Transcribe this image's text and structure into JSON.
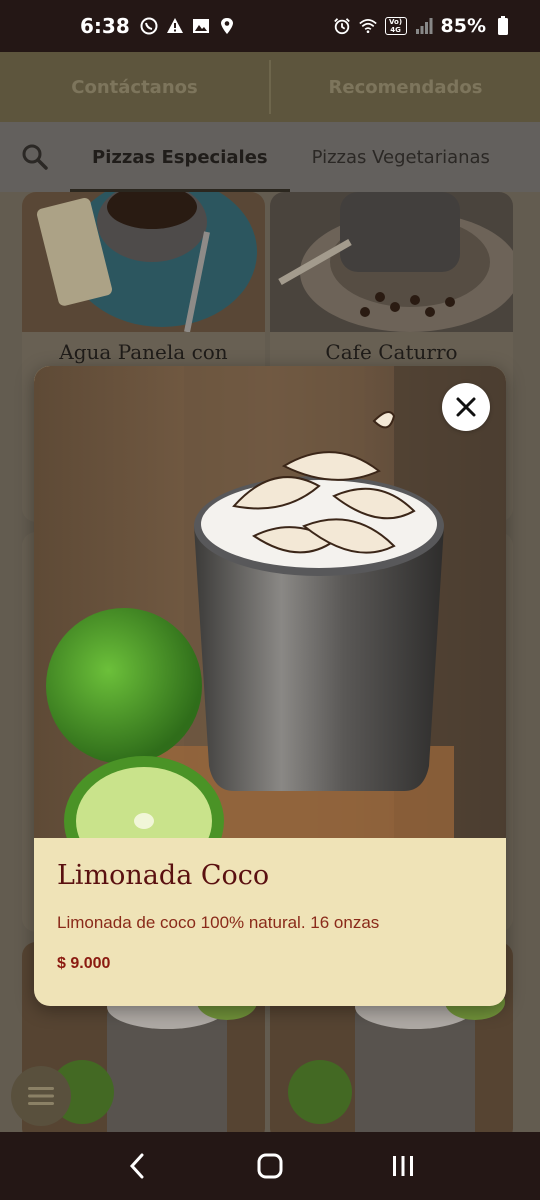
{
  "status_bar": {
    "time": "6:38",
    "left_icons": [
      "whatsapp-icon",
      "warning-icon",
      "image-icon",
      "location-icon"
    ],
    "right_icons": [
      "alarm-icon",
      "wifi-icon",
      "volte-icon",
      "signal-icon",
      "battery-icon"
    ],
    "volte_label": "Vo) 4G",
    "battery": "85%"
  },
  "header": {
    "tabs": [
      {
        "label": "Contáctanos"
      },
      {
        "label": "Recomendados"
      }
    ]
  },
  "categories": {
    "search_icon": "search-icon",
    "items": [
      {
        "label": "Pizzas Especiales",
        "active": true
      },
      {
        "label": "Pizzas Vegetarianas",
        "active": false
      }
    ]
  },
  "products_background": [
    {
      "title": "Agua Panela con"
    },
    {
      "title": "Cafe Caturro"
    }
  ],
  "modal": {
    "product_name": "Limonada Coco",
    "description": "Limonada de coco 100% natural. 16 onzas",
    "price": "$ 9.000",
    "close_icon": "close-icon"
  },
  "fab": {
    "icon": "menu-icon"
  },
  "nav_bar": {
    "buttons": [
      "back-icon",
      "home-icon",
      "recents-icon"
    ]
  },
  "colors": {
    "modal_panel": "#efe3b7",
    "product_name": "#5a1010",
    "price": "#8a1a10",
    "header_bg": "#756e50"
  }
}
